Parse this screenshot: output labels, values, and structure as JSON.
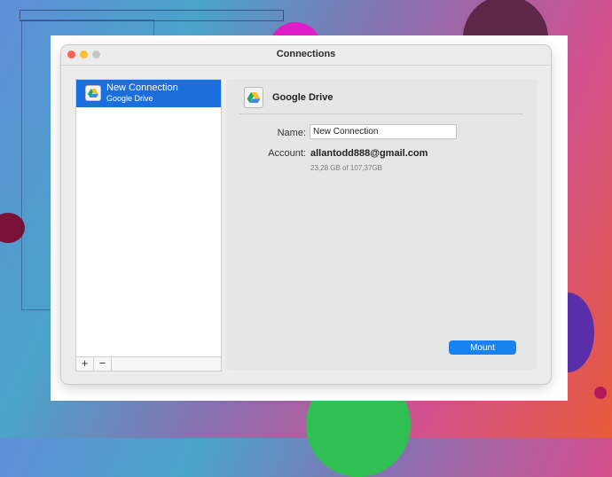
{
  "window": {
    "title": "Connections"
  },
  "sidebar": {
    "items": [
      {
        "title": "New Connection",
        "subtitle": "Google Drive",
        "icon": "google-drive-icon"
      }
    ],
    "add_label": "+",
    "remove_label": "−"
  },
  "detail": {
    "service_name": "Google Drive",
    "service_icon": "google-drive-icon",
    "name_label": "Name:",
    "name_value": "New Connection",
    "account_label": "Account:",
    "account_value": "allantodd888@gmail.com",
    "storage": "23,28 GB of 107,37GB",
    "mount_label": "Mount"
  },
  "colors": {
    "selection": "#1a6fdc",
    "mount_button": "#1a82f0",
    "close": "#ff5f57",
    "minimize": "#febc2e",
    "zoom": "#c7c7c7"
  }
}
